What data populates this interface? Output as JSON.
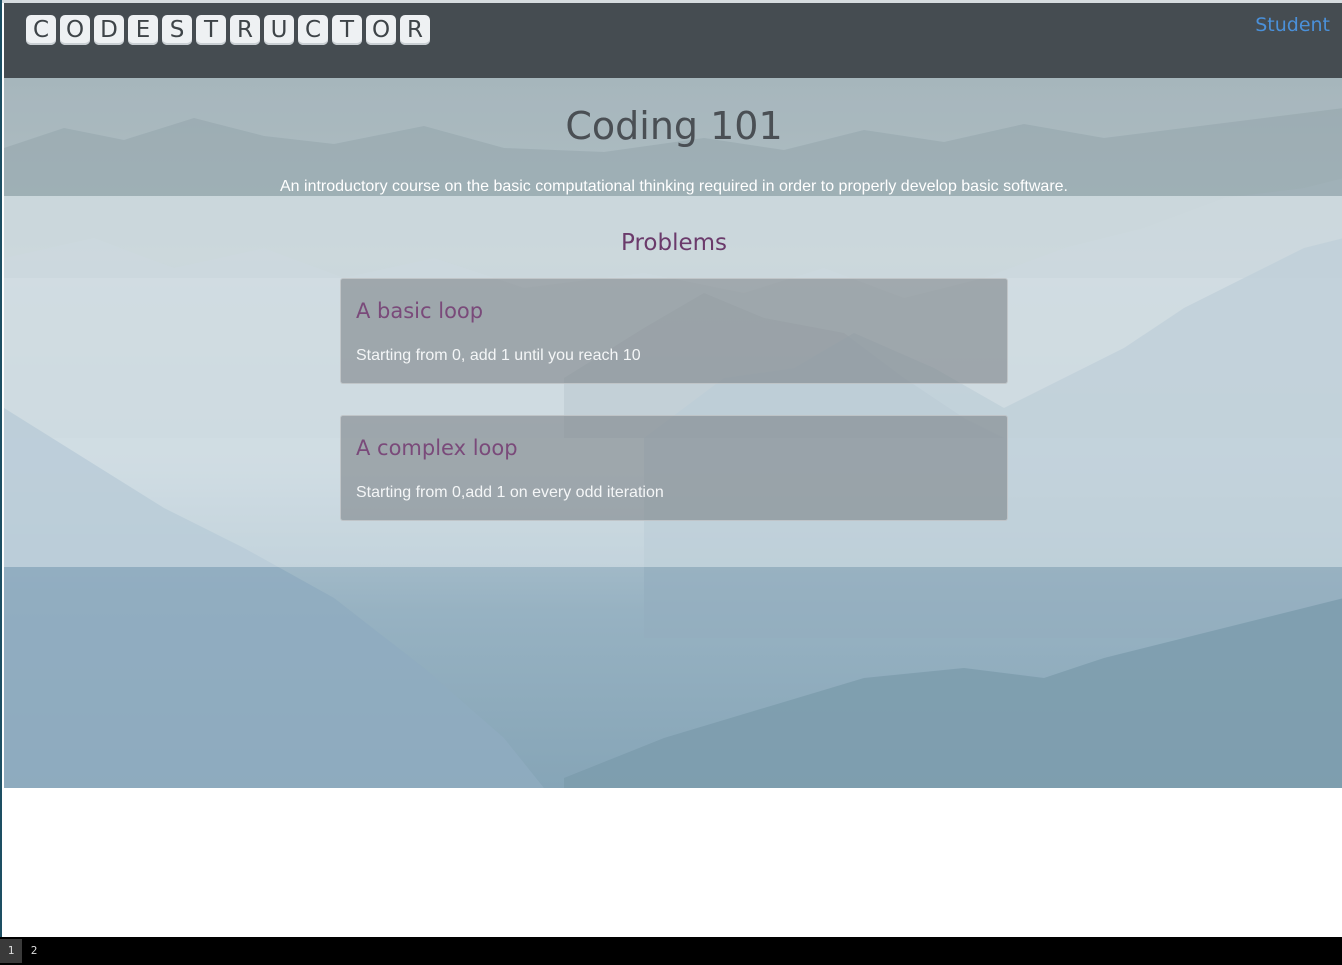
{
  "app": {
    "logo_letters": [
      "C",
      "O",
      "D",
      "E",
      "S",
      "T",
      "R",
      "U",
      "C",
      "T",
      "O",
      "R"
    ],
    "user_link": "Student"
  },
  "course": {
    "title": "Coding 101",
    "description": "An introductory course on the basic computational thinking required in order to properly develop basic software."
  },
  "problems": {
    "heading": "Problems",
    "items": [
      {
        "title": "A basic loop",
        "description": "Starting from 0, add 1 until you reach 10"
      },
      {
        "title": "A complex loop",
        "description": "Starting from 0,add 1 on every odd iteration"
      }
    ]
  },
  "statusbar": {
    "workspaces": [
      "1",
      "2"
    ],
    "active_workspace": "1"
  },
  "colors": {
    "header_bg": "#454c51",
    "link": "#4a90d9",
    "accent_purple": "#6b3a6b"
  }
}
